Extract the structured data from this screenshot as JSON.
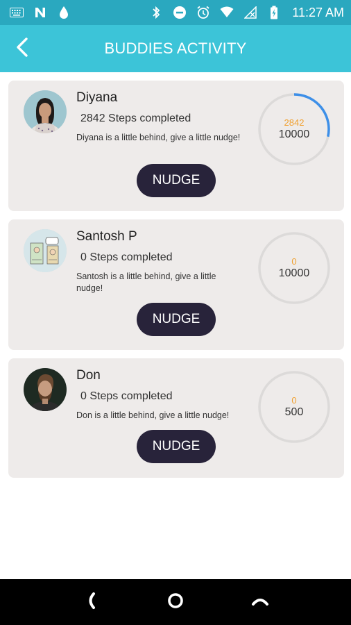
{
  "status_bar": {
    "time": "11:27 AM",
    "left_icons": [
      "keyboard-icon",
      "n-app-icon",
      "drop-icon"
    ],
    "right_icons": [
      "bluetooth-icon",
      "dnd-icon",
      "alarm-icon",
      "wifi-icon",
      "no-signal-icon",
      "battery-charging-icon"
    ]
  },
  "app_bar": {
    "title": "BUDDIES ACTIVITY",
    "back_icon": "back-arrow-icon",
    "color": "#3cc4d8"
  },
  "colors": {
    "status_bar": "#2aa8bf",
    "card_bg": "#eeebea",
    "nudge_button": "#28233a",
    "ring_progress": "#3d8fe8",
    "ring_track": "#dcdad9",
    "current_steps": "#f0a030"
  },
  "buddies": [
    {
      "name": "Diyana",
      "steps_text": "2842 Steps completed",
      "message": "Diyana is a little behind, give a little nudge!",
      "nudge_label": "NUDGE",
      "current": "2842",
      "goal": "10000",
      "progress": 0.2842
    },
    {
      "name": "Santosh P",
      "steps_text": "0 Steps completed",
      "message": "Santosh is a little behind, give a little nudge!",
      "nudge_label": "NUDGE",
      "current": "0",
      "goal": "10000",
      "progress": 0
    },
    {
      "name": "Don",
      "steps_text": "0 Steps completed",
      "message": "Don is a little behind, give a little nudge!",
      "nudge_label": "NUDGE",
      "current": "0",
      "goal": "500",
      "progress": 0
    }
  ],
  "nav_bar": {
    "buttons": [
      "back-nav-icon",
      "home-nav-icon",
      "recents-nav-icon"
    ]
  }
}
